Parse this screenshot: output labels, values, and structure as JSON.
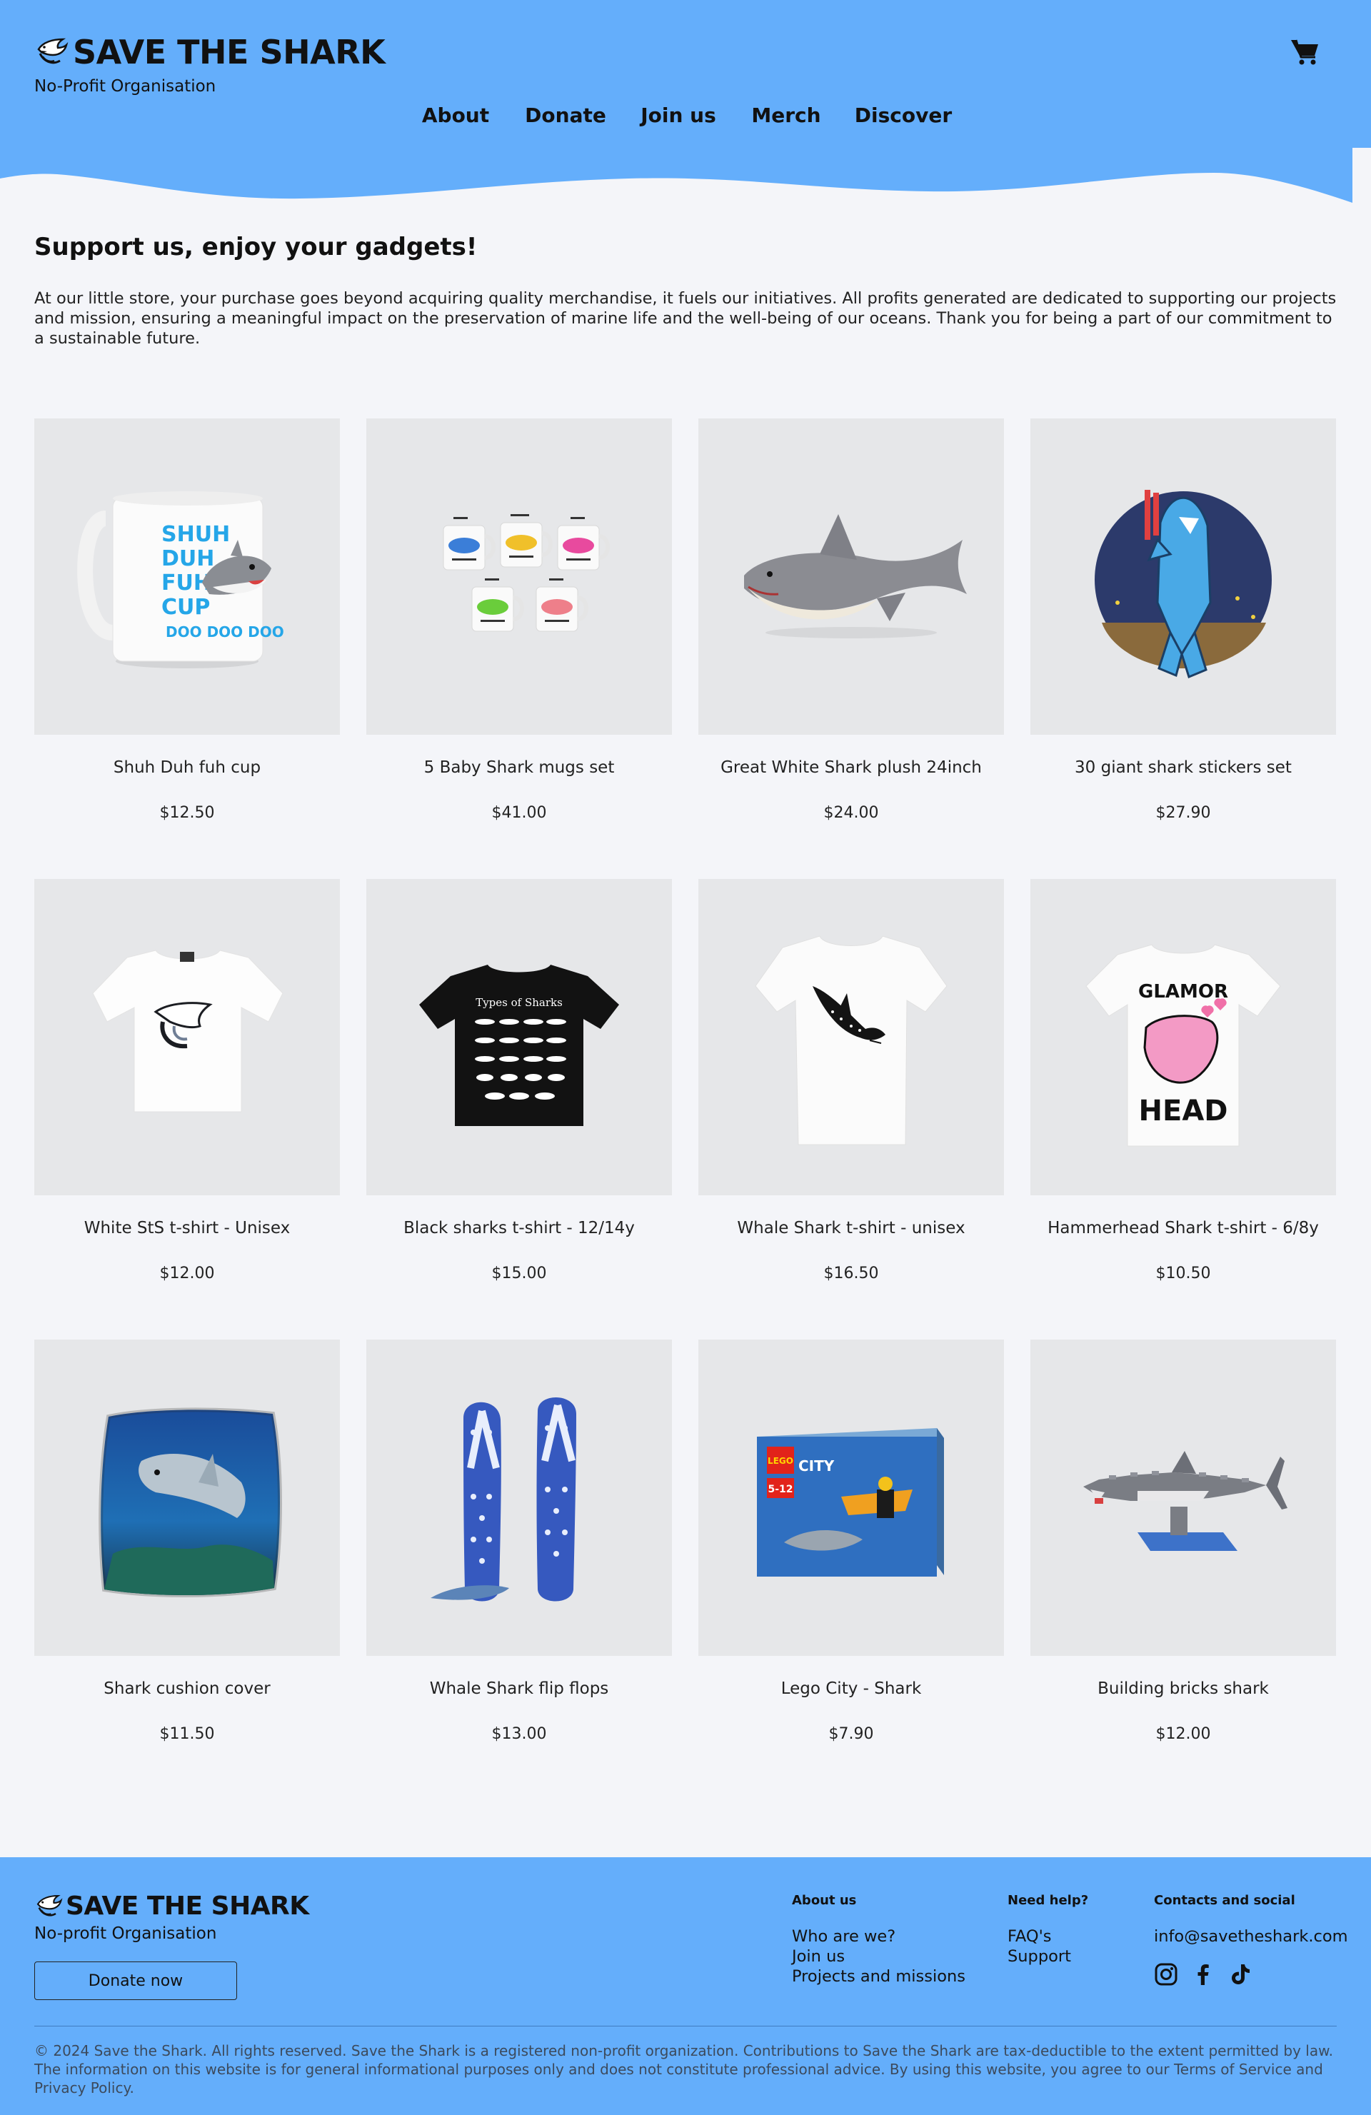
{
  "colors": {
    "brand_blue": "#64aefb",
    "page_bg": "#f4f5f9",
    "tile_bg": "#e6e7e9"
  },
  "header": {
    "title": "SAVE THE SHARK",
    "subtitle": "No-Profit Organisation",
    "nav": [
      "About",
      "Donate",
      "Join us",
      "Merch",
      "Discover"
    ],
    "cart_icon": "shopping-cart-icon",
    "logo_icon": "shark-logo-icon"
  },
  "intro": {
    "title": "Support us, enjoy your gadgets!",
    "text": "At our little store, your purchase goes beyond acquiring quality merchandise, it fuels our initiatives. All profits generated are dedicated to supporting our projects and mission, ensuring a meaningful impact on the preservation of marine life and the well-being of our oceans. Thank you for being a part of our commitment to a sustainable future."
  },
  "products": [
    {
      "name": "Shuh Duh fuh cup",
      "price": "$12.50"
    },
    {
      "name": "5 Baby Shark mugs set",
      "price": "$41.00"
    },
    {
      "name": "Great White Shark plush 24inch",
      "price": "$24.00"
    },
    {
      "name": "30 giant shark stickers set",
      "price": "$27.90"
    },
    {
      "name": "White StS t-shirt - Unisex",
      "price": "$12.00"
    },
    {
      "name": "Black sharks t-shirt - 12/14y",
      "price": "$15.00"
    },
    {
      "name": "Whale Shark t-shirt - unisex",
      "price": "$16.50"
    },
    {
      "name": "Hammerhead Shark t-shirt - 6/8y",
      "price": "$10.50"
    },
    {
      "name": "Shark cushion cover",
      "price": "$11.50"
    },
    {
      "name": "Whale Shark flip flops",
      "price": "$13.00"
    },
    {
      "name": "Lego City - Shark",
      "price": "$7.90"
    },
    {
      "name": "Building bricks shark",
      "price": "$12.00"
    }
  ],
  "product_art": {
    "mug_text": [
      "SHUH",
      "DUH",
      "FUH",
      "CUP"
    ],
    "mug_tagline": "DOO DOO DOO",
    "tshirt_black_caption": "Types of Sharks",
    "tshirt_glamor_top": "GLAMOR",
    "tshirt_glamor_bottom": "HEAD",
    "lego_brand": "LEGO",
    "lego_line": "CITY",
    "lego_age": "5-12"
  },
  "footer": {
    "title": "SAVE THE SHARK",
    "subtitle": "No-profit Organisation",
    "donate_label": "Donate now",
    "columns": {
      "about": {
        "heading": "About us",
        "links": [
          "Who are we?",
          "Join us",
          "Projects and missions"
        ]
      },
      "help": {
        "heading": "Need help?",
        "links": [
          "FAQ's",
          "Support"
        ]
      },
      "contacts": {
        "heading": "Contacts and social",
        "email": "info@savetheshark.com"
      }
    },
    "socials": [
      "instagram-icon",
      "facebook-icon",
      "tiktok-icon"
    ],
    "legal": "© 2024 Save the Shark. All rights reserved. Save the Shark is a registered non-profit organization. Contributions to Save the Shark are tax-deductible to the extent permitted by law. The information on this website is for general informational purposes only and does not constitute professional advice. By using this website, you agree to our Terms of Service and Privacy Policy."
  }
}
